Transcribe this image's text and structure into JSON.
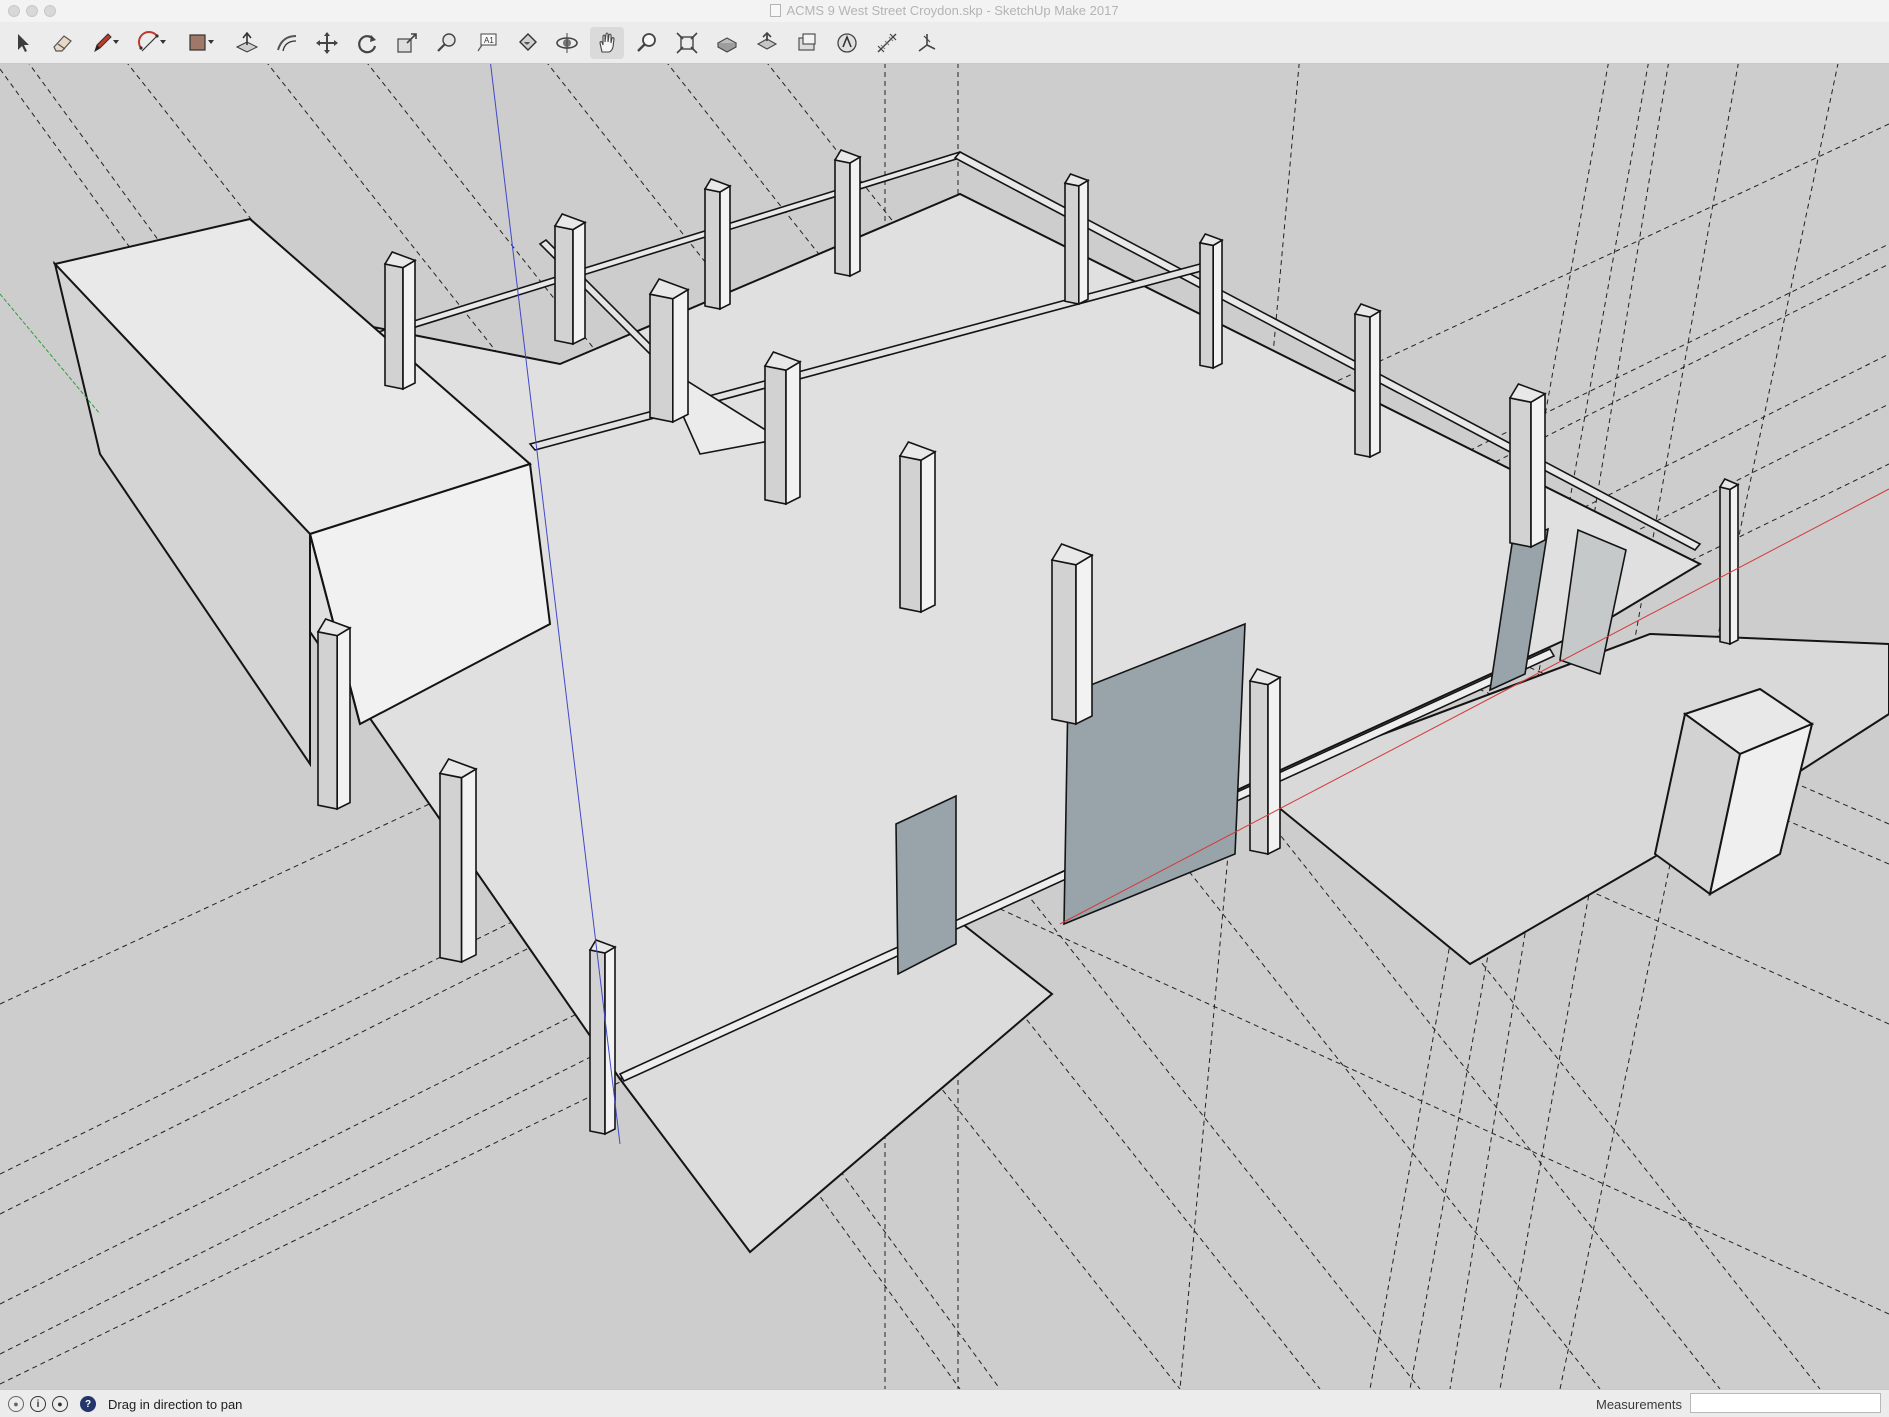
{
  "window": {
    "title": "ACMS 9 West Street Croydon.skp - SketchUp Make 2017",
    "controls": [
      "close",
      "minimize",
      "zoom"
    ]
  },
  "toolbar": {
    "tools": [
      {
        "icon": "select-arrow-icon",
        "label": "Select"
      },
      {
        "icon": "eraser-icon",
        "label": "Eraser"
      },
      {
        "icon": "pencil-line-icon",
        "label": "Line",
        "dropdown": true
      },
      {
        "icon": "arc-icon",
        "label": "Arc",
        "dropdown": true
      },
      {
        "icon": "rectangle-shape-icon",
        "label": "Shapes",
        "dropdown": true
      },
      {
        "icon": "push-pull-icon",
        "label": "Push/Pull"
      },
      {
        "icon": "offset-icon",
        "label": "Offset"
      },
      {
        "icon": "move-icon",
        "label": "Move"
      },
      {
        "icon": "rotate-icon",
        "label": "Rotate"
      },
      {
        "icon": "scale-icon",
        "label": "Scale"
      },
      {
        "icon": "tape-measure-icon",
        "label": "Tape Measure"
      },
      {
        "icon": "text-icon",
        "label": "Text"
      },
      {
        "icon": "paint-bucket-icon",
        "label": "Paint Bucket"
      },
      {
        "icon": "orbit-icon",
        "label": "Orbit"
      },
      {
        "icon": "pan-hand-icon",
        "label": "Pan",
        "active": true
      },
      {
        "icon": "zoom-icon",
        "label": "Zoom"
      },
      {
        "icon": "zoom-extents-icon",
        "label": "Zoom Extents"
      },
      {
        "icon": "warehouse-icon",
        "label": "3D Warehouse"
      },
      {
        "icon": "share-model-icon",
        "label": "Share Model"
      },
      {
        "icon": "extension-warehouse-icon",
        "label": "Extension Warehouse"
      },
      {
        "icon": "layout-icon",
        "label": "Send to LayOut"
      },
      {
        "icon": "dimensions-icon",
        "label": "Dimensions"
      },
      {
        "icon": "axes-icon",
        "label": "Axes"
      }
    ]
  },
  "viewport": {
    "background": "#cdcdcd",
    "colors": {
      "floor": "#dfdfdf",
      "wall_top": "#e6e6e6",
      "wall_face": "#f0f0f0",
      "wall_side": "#d6d6d6",
      "window_glass": "#98a4a9",
      "edge": "#141414",
      "guide": "#222222",
      "axis_red": "#d23a3a",
      "axis_green": "#2f9e3a",
      "axis_blue": "#3f49c8"
    },
    "active_tool": "pan-hand-icon"
  },
  "status": {
    "icons": [
      "geo-location-icon",
      "credits-icon",
      "user-account-icon",
      "help-icon"
    ],
    "message": "Drag in direction to pan",
    "measurements_label": "Measurements",
    "measurements_value": ""
  }
}
